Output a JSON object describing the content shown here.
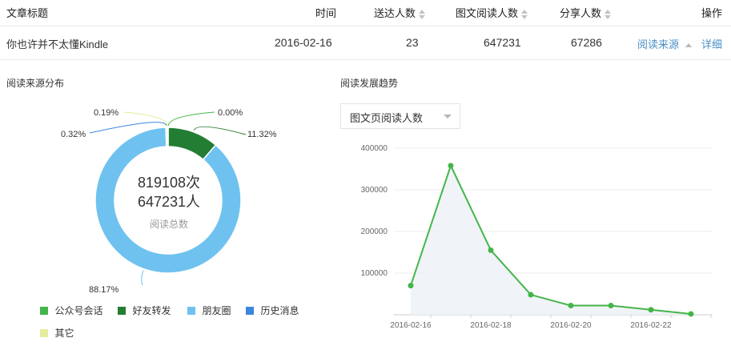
{
  "table": {
    "headers": {
      "title": "文章标题",
      "time": "时间",
      "delivered": "送达人数",
      "readers": "图文阅读人数",
      "sharers": "分享人数",
      "actions": "操作"
    },
    "row": {
      "title": "你也许并不太懂Kindle",
      "time": "2016-02-16",
      "delivered": "23",
      "readers": "647231",
      "sharers": "67286",
      "source_link": "阅读来源",
      "detail_link": "详细"
    }
  },
  "left_panel": {
    "title": "阅读来源分布",
    "center": {
      "times": "819108次",
      "people": "647231人",
      "caption": "阅读总数"
    }
  },
  "right_panel": {
    "title": "阅读发展趋势",
    "select_value": "图文页阅读人数"
  },
  "colors": {
    "public_account": "#44b549",
    "friend_forward": "#237d33",
    "moments": "#6fc2f0",
    "history": "#3b87dc",
    "other": "#e6ec9c",
    "link": "#4a90c8",
    "line": "#44b549"
  },
  "chart_data": [
    {
      "type": "pie",
      "title": "阅读来源分布",
      "variant": "donut",
      "categories": [
        "公众号会话",
        "好友转发",
        "朋友圈",
        "历史消息",
        "其它"
      ],
      "values": [
        0.0,
        11.32,
        88.17,
        0.32,
        0.19
      ],
      "labels": [
        "0.00%",
        "11.32%",
        "88.17%",
        "0.32%",
        "0.19%"
      ],
      "legend": "bottom"
    },
    {
      "type": "line",
      "title": "阅读发展趋势",
      "x": [
        "2016-02-16",
        "2016-02-17",
        "2016-02-18",
        "2016-02-19",
        "2016-02-20",
        "2016-02-21",
        "2016-02-22",
        "2016-02-23"
      ],
      "x_tick_labels": [
        "2016-02-16",
        "2016-02-18",
        "2016-02-20",
        "2016-02-22"
      ],
      "series": [
        {
          "values": [
            70000,
            358000,
            155000,
            48000,
            22000,
            22000,
            12000,
            2000
          ]
        }
      ],
      "y_ticks": [
        "100000",
        "200000",
        "300000",
        "400000"
      ],
      "ylim": [
        0,
        400000
      ],
      "grid": true
    }
  ]
}
